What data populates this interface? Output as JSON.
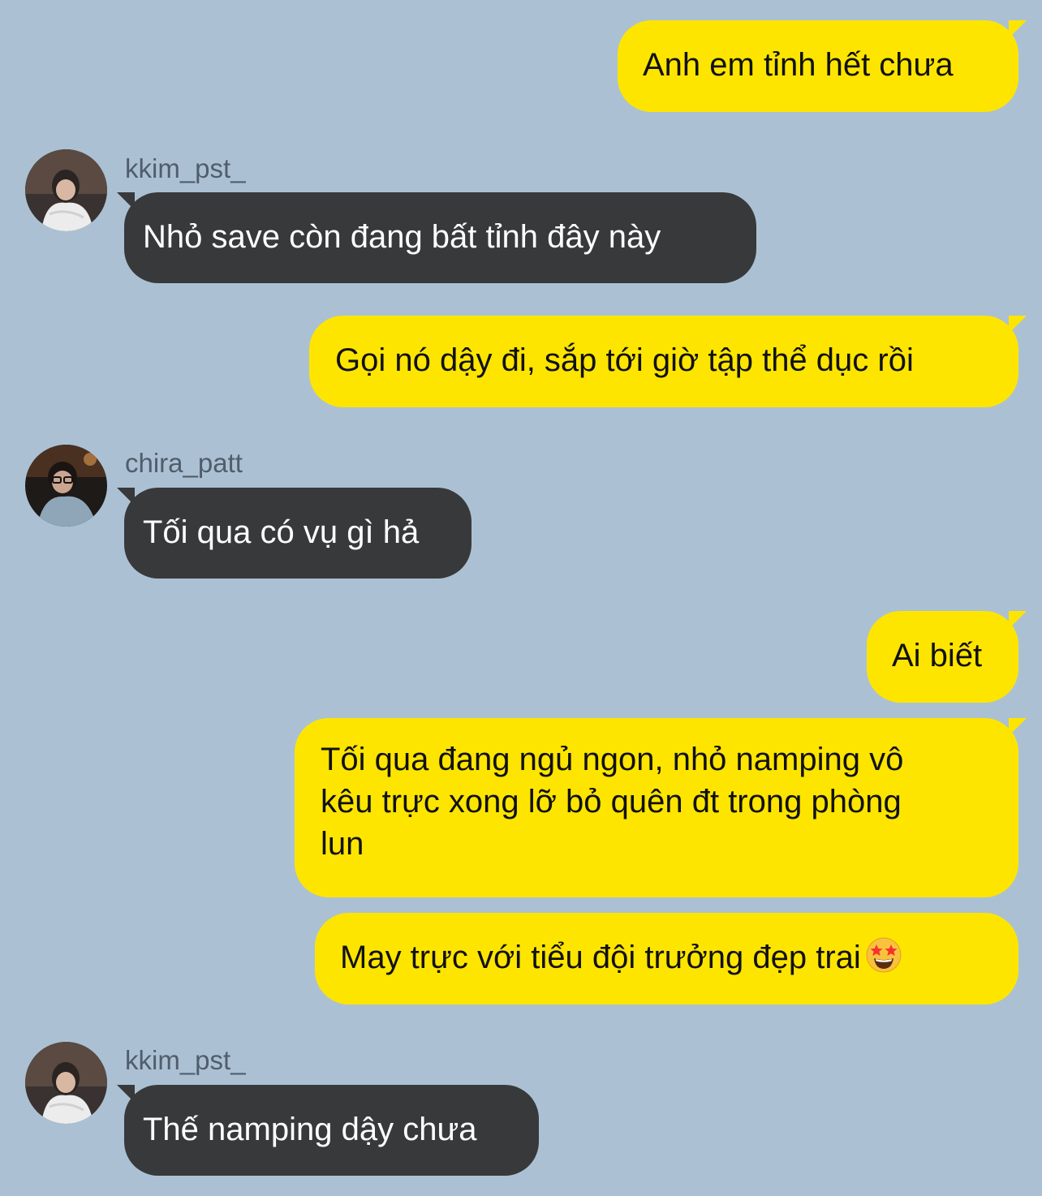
{
  "colors": {
    "background": "#abc1d3",
    "outgoing_bubble": "#fee500",
    "incoming_bubble": "#38393b",
    "sender_name": "#505d6c"
  },
  "messages": [
    {
      "direction": "out",
      "text": "Anh em tỉnh hết chưa"
    },
    {
      "direction": "in",
      "sender": "kkim_pst_",
      "avatar": "kkim-avatar",
      "text": "Nhỏ save còn đang bất tỉnh đây này"
    },
    {
      "direction": "out",
      "text": "Gọi nó dậy đi, sắp tới giờ tập thể dục rồi"
    },
    {
      "direction": "in",
      "sender": "chira_patt",
      "avatar": "chira-avatar",
      "text": "Tối qua có vụ gì hả"
    },
    {
      "direction": "out",
      "text": "Ai biết"
    },
    {
      "direction": "out",
      "lines": [
        "Tối qua đang ngủ ngon, nhỏ namping vô",
        "kêu trực xong lỡ bỏ quên đt trong phòng",
        "lun"
      ]
    },
    {
      "direction": "out",
      "text": "May trực với tiểu đội trưởng đẹp trai",
      "emoji": "star-struck-emoji"
    },
    {
      "direction": "in",
      "sender": "kkim_pst_",
      "avatar": "kkim-avatar",
      "text": "Thế namping dậy chưa"
    }
  ]
}
